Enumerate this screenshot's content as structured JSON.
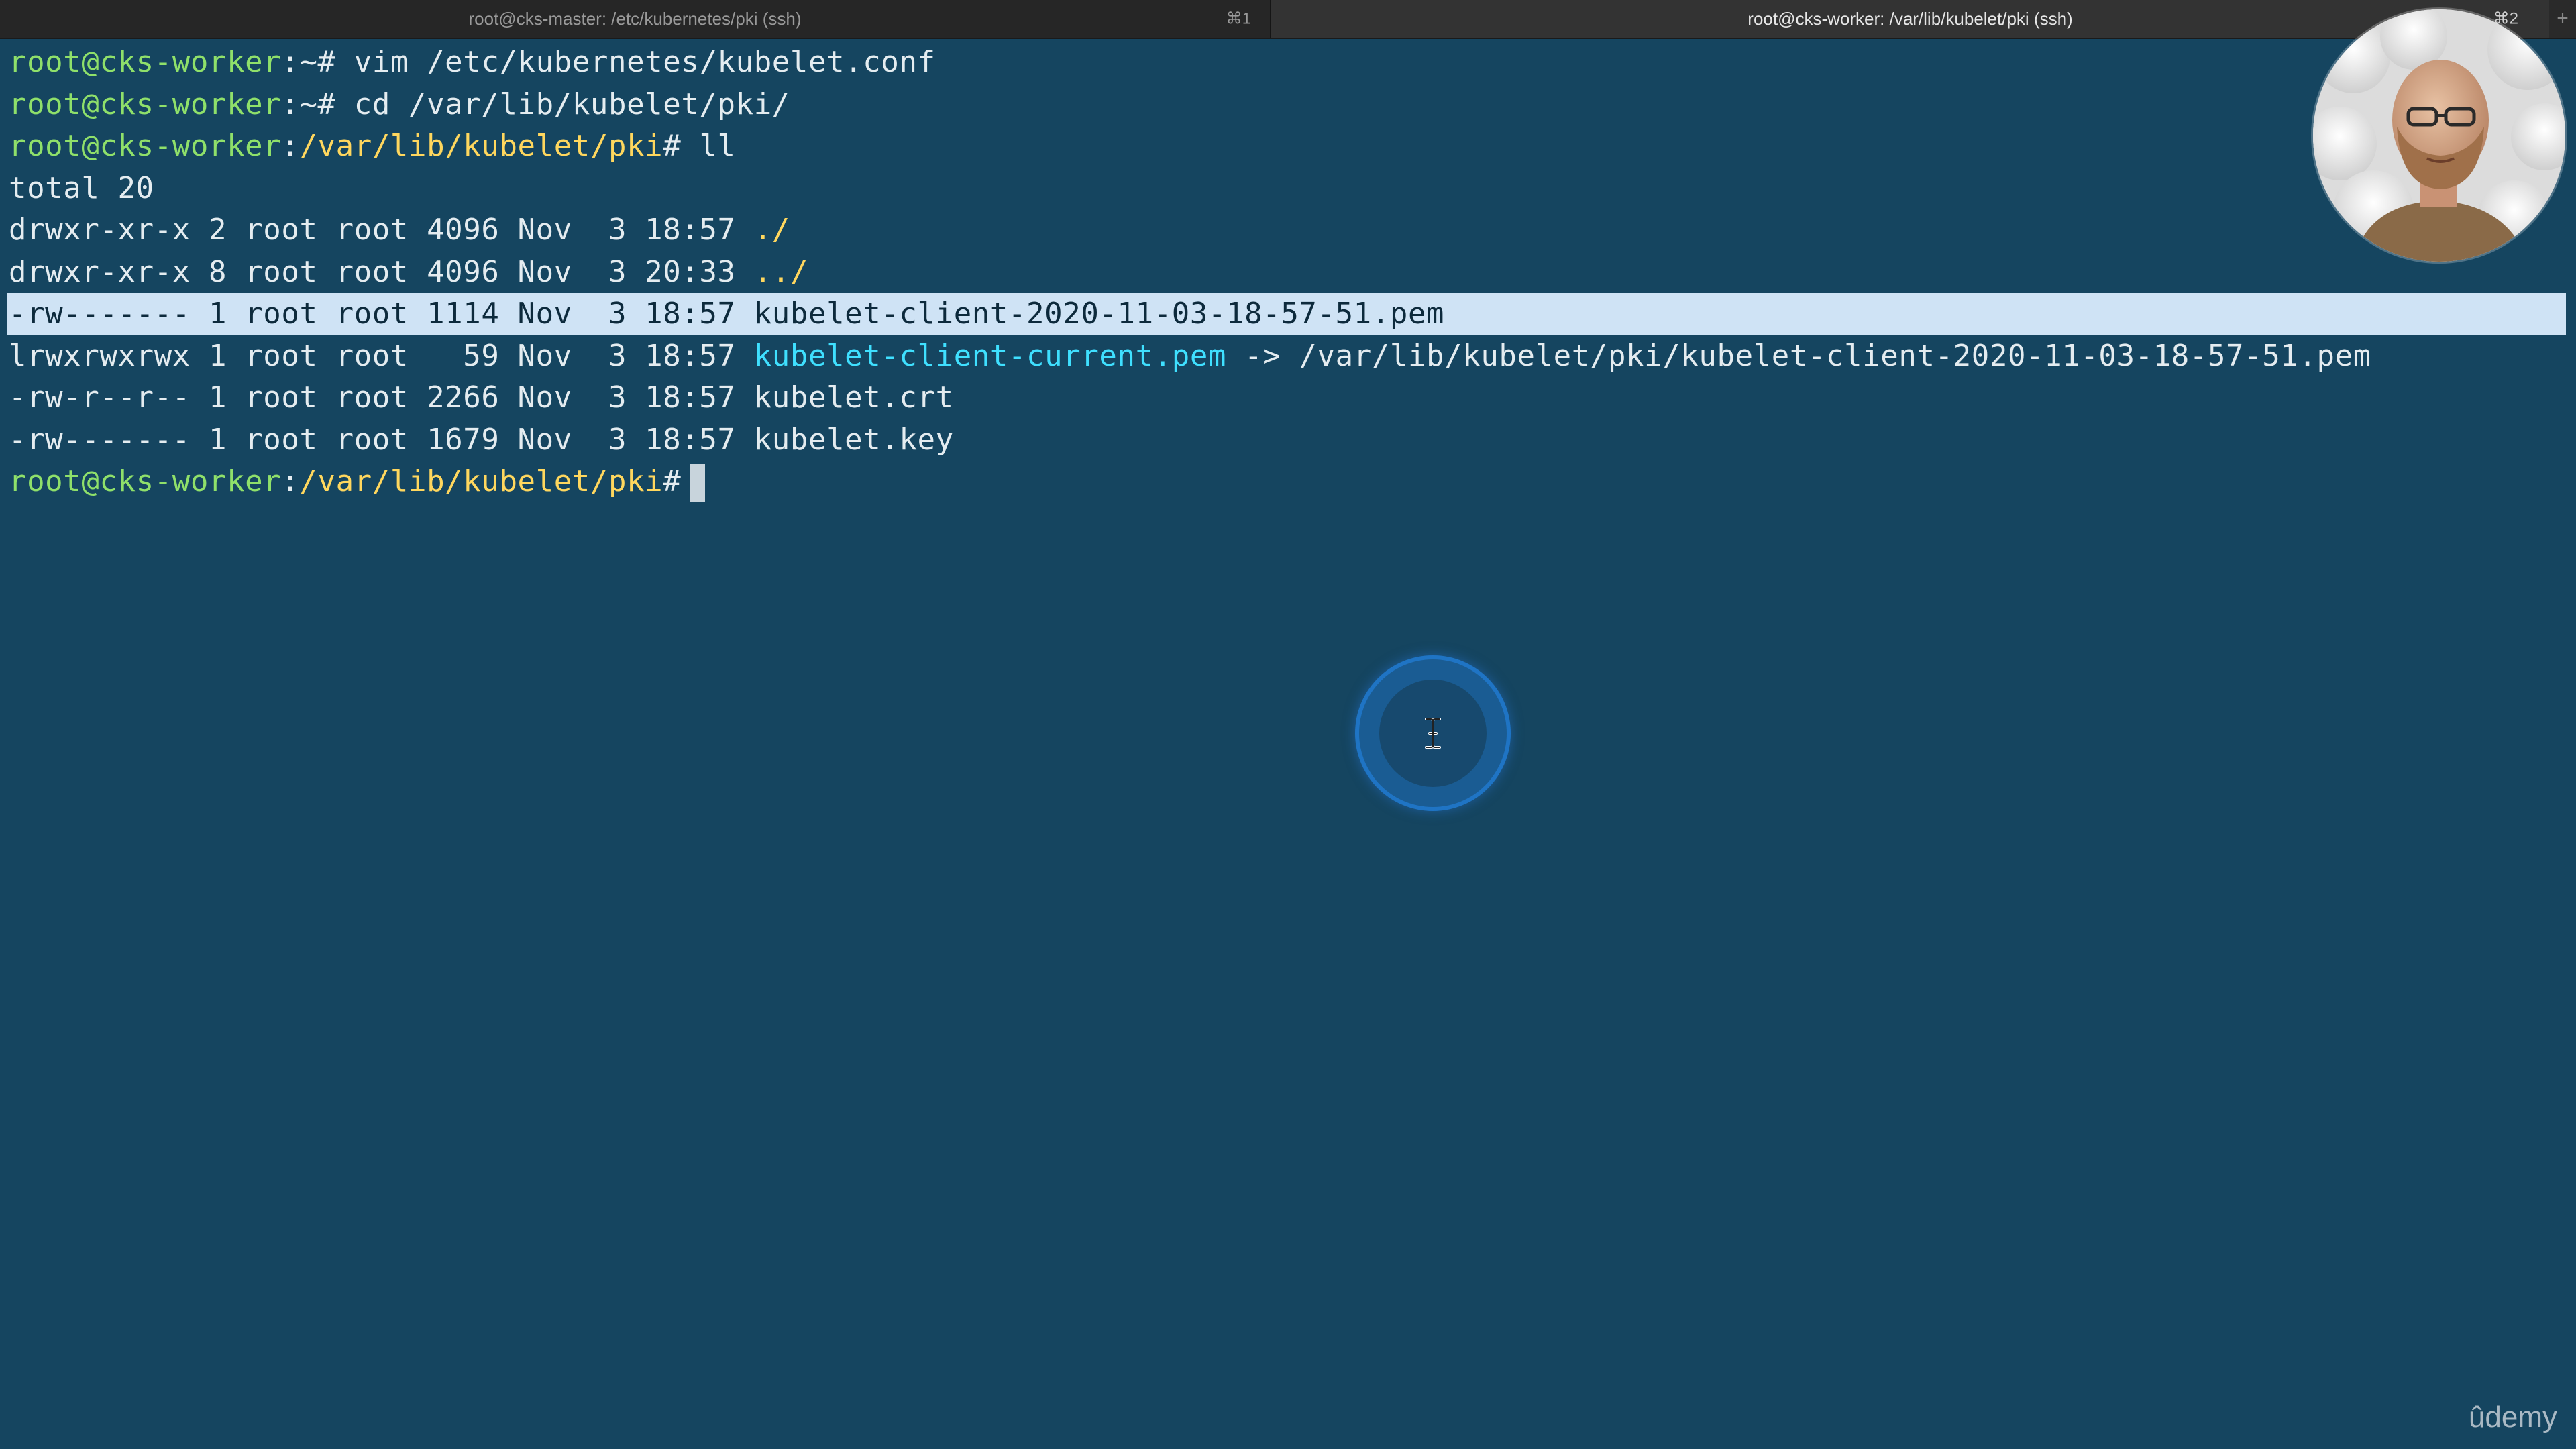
{
  "tabs": [
    {
      "title": "root@cks-master: /etc/kubernetes/pki (ssh)",
      "shortcut": "⌘1",
      "active": false
    },
    {
      "title": "root@cks-worker: /var/lib/kubelet/pki (ssh)",
      "shortcut": "⌘2",
      "active": true
    }
  ],
  "new_tab_label": "+",
  "terminal": {
    "lines": [
      {
        "user": "root@cks-worker",
        "sep": ":",
        "path": "~",
        "symbol": "# ",
        "cmd": "vim /etc/kubernetes/kubelet.conf"
      },
      {
        "user": "root@cks-worker",
        "sep": ":",
        "path": "~",
        "symbol": "# ",
        "cmd": "cd /var/lib/kubelet/pki/"
      },
      {
        "user": "root@cks-worker",
        "sep": ":",
        "path": "/var/lib/kubelet/pki",
        "symbol": "# ",
        "cmd": "ll"
      },
      {
        "text": "total 20"
      },
      {
        "meta": "drwxr-xr-x 2 root root 4096 Nov  3 18:57 ",
        "name": "./"
      },
      {
        "meta": "drwxr-xr-x 8 root root 4096 Nov  3 20:33 ",
        "name": "../"
      },
      {
        "meta": "-rw------- 1 root root 1114 Nov  3 18:57 ",
        "name": "kubelet-client-2020-11-03-18-57-51.pem"
      },
      {
        "meta": "lrwxrwxrwx 1 root root   59 Nov  3 18:57 ",
        "name": "kubelet-client-current.pem",
        "target": " -> /var/lib/kubelet/pki/kubelet-client-2020-11-03-18-57-51.pem"
      },
      {
        "meta": "-rw-r--r-- 1 root root 2266 Nov  3 18:57 ",
        "name": "kubelet.crt"
      },
      {
        "meta": "-rw------- 1 root root 1679 Nov  3 18:57 ",
        "name": "kubelet.key"
      },
      {
        "user": "root@cks-worker",
        "sep": ":",
        "path": "/var/lib/kubelet/pki",
        "symbol": "#"
      }
    ]
  },
  "watermark": "ûdemy",
  "colors": {
    "background": "#154560",
    "prompt_user": "#8fe06a",
    "prompt_path": "#ffd75e",
    "symlink": "#3fe0ff",
    "highlight": "#cfe3f5",
    "click_ring": "#1f74c4"
  }
}
